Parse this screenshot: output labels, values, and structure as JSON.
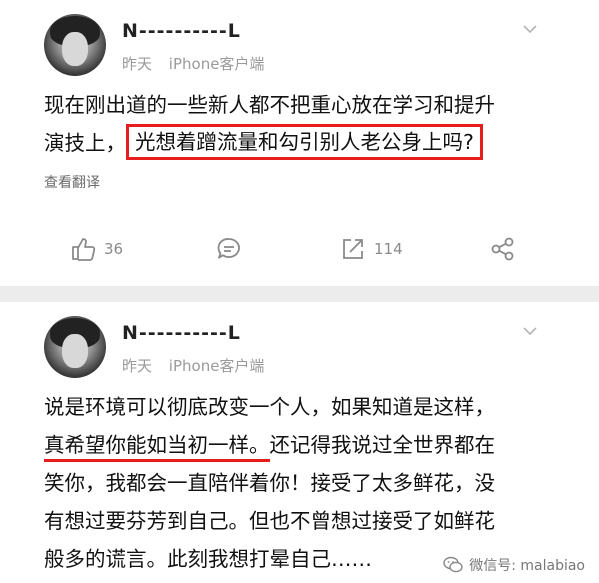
{
  "post1": {
    "username": "N----------L",
    "time": "昨天",
    "source": "iPhone客户端",
    "content_line1": "现在刚出道的一些新人都不把重心放在学习和提升",
    "content_line2_prefix": "演技上，",
    "content_line2_highlight": "光想着蹭流量和勾引别人老公身上吗?",
    "translate_label": "查看翻译",
    "actions": {
      "like_count": "36",
      "repost_count": "114"
    }
  },
  "post2": {
    "username": "N----------L",
    "time": "昨天",
    "source": "iPhone客户端",
    "content_line1": "说是环境可以彻底改变一个人，如果知道是这样，",
    "content_line2_highlight": "真希望你能如当初一样。",
    "content_line2_rest": "还记得我说过全世界都在",
    "content_line3": "笑你，我都会一直陪伴着你！接受了太多鲜花，没",
    "content_line4": "有想过要芬芳到自己。但也不曾想过接受了如鲜花",
    "content_line5": "般多的谎言。此刻我想打晕自己……"
  },
  "watermark": {
    "text": "微信号: malabiao"
  },
  "colors": {
    "highlight": "#e51d1d",
    "separator": "#ececec",
    "meta_text": "#9a9a9a"
  },
  "icons": [
    "chevron-down-icon",
    "thumbs-up-icon",
    "comment-icon",
    "repost-icon",
    "share-icon",
    "wechat-icon"
  ]
}
